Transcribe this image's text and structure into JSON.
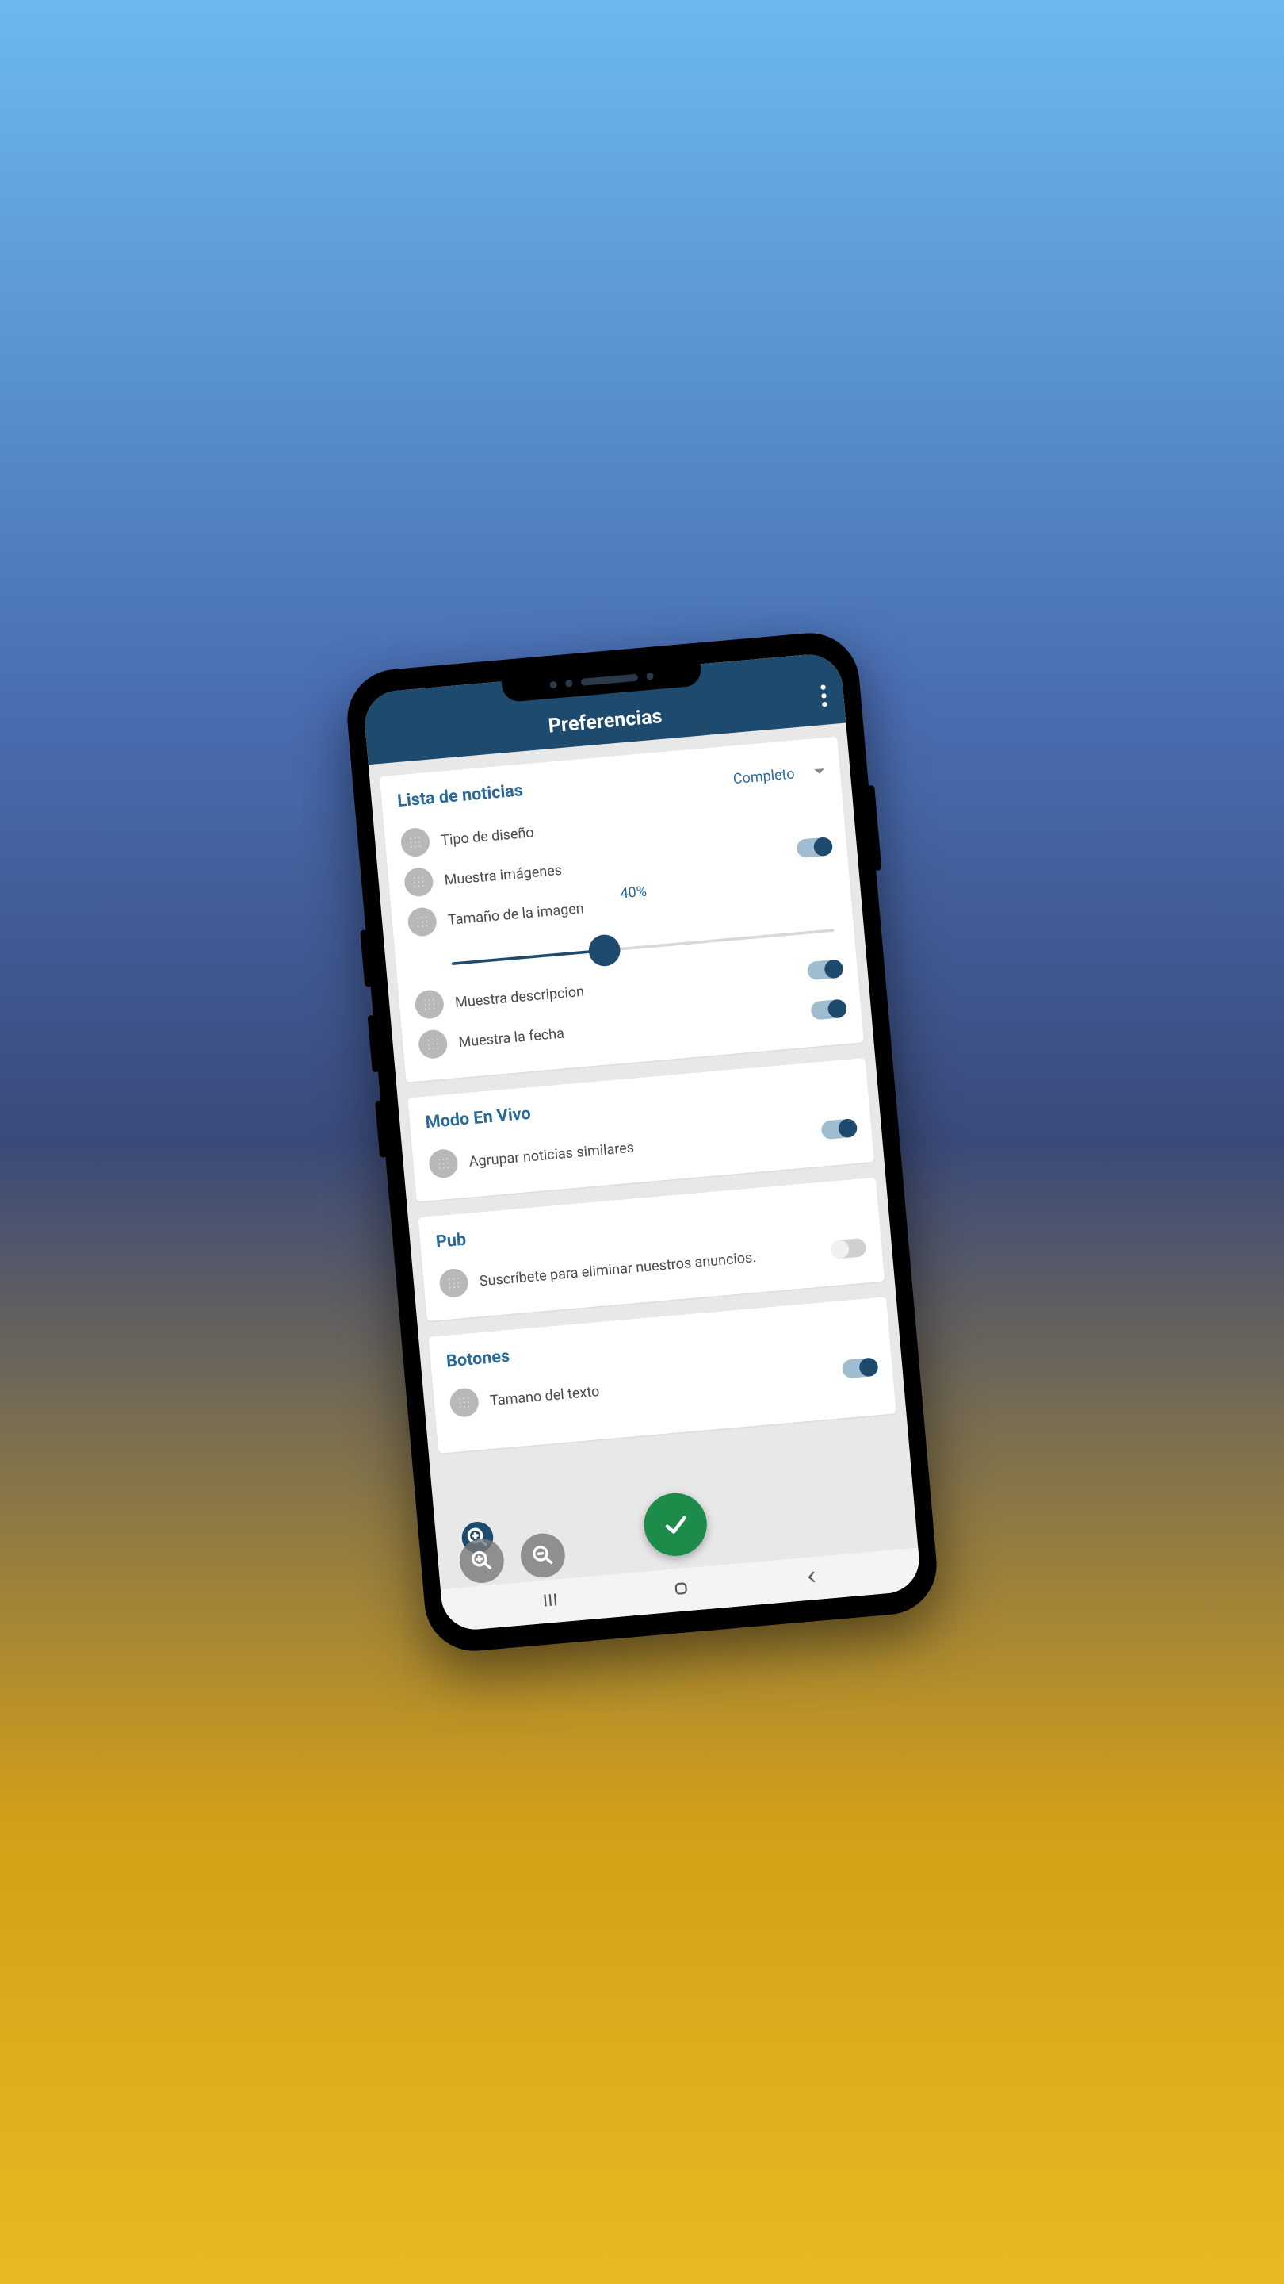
{
  "header": {
    "title": "Preferencias"
  },
  "sections": {
    "news_list": {
      "title": "Lista de noticias",
      "design_type": {
        "label": "Tipo de diseño",
        "value": "Completo"
      },
      "show_images": {
        "label": "Muestra imágenes",
        "on": true
      },
      "image_size": {
        "label": "Tamaño de la imagen",
        "percent": "40%",
        "value": 40
      },
      "show_description": {
        "label": "Muestra descripcion",
        "on": true
      },
      "show_date": {
        "label": "Muestra la fecha",
        "on": true
      }
    },
    "live_mode": {
      "title": "Modo En Vivo",
      "group_similar": {
        "label": "Agrupar noticias similares",
        "on": true
      }
    },
    "pub": {
      "title": "Pub",
      "subscribe": {
        "label": "Suscríbete para eliminar nuestros anuncios.",
        "on": false
      }
    },
    "buttons": {
      "title": "Botones",
      "text_size": {
        "label": "Tamano del texto",
        "on": true
      }
    }
  }
}
